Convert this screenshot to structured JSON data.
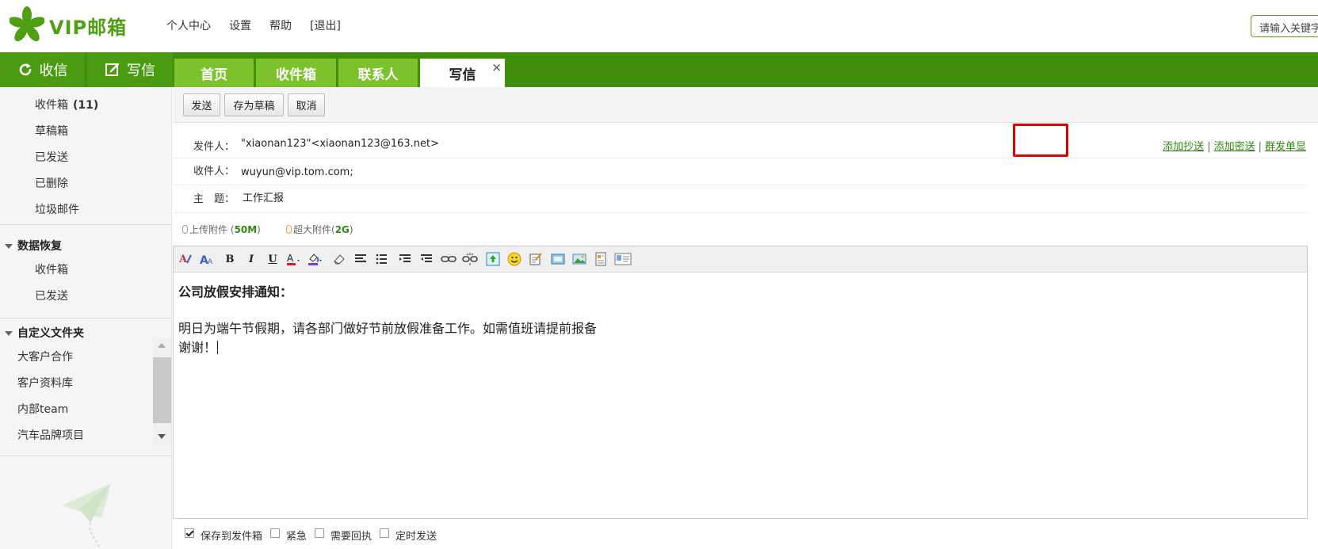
{
  "brand": {
    "logo_text": "VIP邮箱",
    "accent": "#4a9a12",
    "tab_green": "#7cc22c",
    "bar_green": "#3f8f0a"
  },
  "top_nav": [
    "个人中心",
    "设置",
    "帮助",
    "[退出]"
  ],
  "search": {
    "placeholder": "请输入关键字"
  },
  "actions": {
    "receive": "收信",
    "compose": "写信"
  },
  "tabs": {
    "home": "首页",
    "inbox": "收件箱",
    "contacts": "联系人",
    "write": "写信",
    "close": "×"
  },
  "sidebar": {
    "folders": [
      {
        "label": "收件箱",
        "count": "(11)"
      },
      {
        "label": "草稿箱"
      },
      {
        "label": "已发送"
      },
      {
        "label": "已删除"
      },
      {
        "label": "垃圾邮件"
      }
    ],
    "recovery": {
      "title": "数据恢复",
      "items": [
        "收件箱",
        "已发送"
      ]
    },
    "custom": {
      "title": "自定义文件夹",
      "items": [
        "大客户合作",
        "客户资料库",
        "内部team",
        "汽车品牌项目"
      ]
    }
  },
  "toolbar": {
    "send": "发送",
    "draft": "存为草稿",
    "cancel": "取消"
  },
  "compose": {
    "from_label": "发件人：",
    "from_value": "\"xiaonan123\"<xiaonan123@163.net>",
    "links": {
      "cc": "添加抄送",
      "bcc": "添加密送",
      "separate": "群发单显"
    },
    "to_label": "收件人：",
    "to_value": "wuyun@vip.tom.com;",
    "subject_label": "主　题：",
    "subject_value": "工作汇报",
    "attach_upload": "上传附件",
    "attach_upload_size": "50M",
    "attach_large": "超大附件",
    "attach_large_size": "2G"
  },
  "editor_icons": [
    "font-family-icon",
    "font-size-icon",
    "bold-icon",
    "italic-icon",
    "underline-icon",
    "font-color-icon",
    "highlight-color-icon",
    "eraser-icon",
    "align-icon",
    "bullet-list-icon",
    "indent-icon",
    "outdent-icon",
    "link-icon",
    "unlink-icon",
    "image-icon",
    "emoji-icon",
    "note-icon",
    "screenshot-icon",
    "photo-icon",
    "template-icon",
    "signature-icon"
  ],
  "body": {
    "title": "公司放假安排通知：",
    "line1": "明日为端午节假期，请各部门做好节前放假准备工作。如需值班请提前报备",
    "line2": "谢谢！"
  },
  "options": {
    "save": "保存到发件箱",
    "urgent": "紧急",
    "receipt": "需要回执",
    "scheduled": "定时发送"
  }
}
